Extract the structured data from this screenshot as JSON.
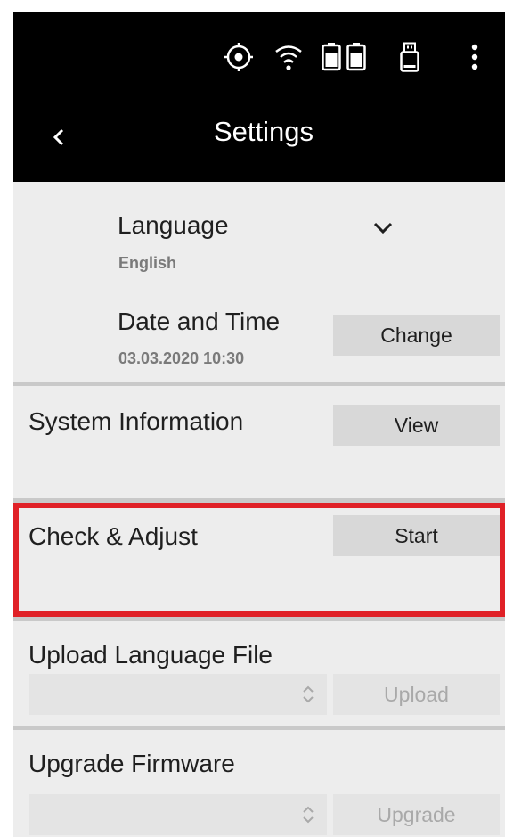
{
  "header": {
    "title": "Settings",
    "status_icons": [
      "target-icon",
      "wifi-icon",
      "battery-icon",
      "battery-icon",
      "usb-drive-icon",
      "more-vertical-icon"
    ]
  },
  "language": {
    "label": "Language",
    "value": "English"
  },
  "date_time": {
    "label": "Date and Time",
    "value": "03.03.2020 10:30",
    "button": "Change"
  },
  "system_info": {
    "label": "System Information",
    "button": "View"
  },
  "check_adjust": {
    "label": "Check & Adjust",
    "button": "Start",
    "highlight_color": "#e02127"
  },
  "upload_language": {
    "label": "Upload Language File",
    "button": "Upload",
    "selected": ""
  },
  "upgrade_firmware": {
    "label": "Upgrade Firmware",
    "button": "Upgrade",
    "selected": ""
  },
  "colors": {
    "header_bg": "#000000",
    "content_bg": "#ededed",
    "button_bg": "#d8d8d8",
    "highlight": "#e02127"
  }
}
